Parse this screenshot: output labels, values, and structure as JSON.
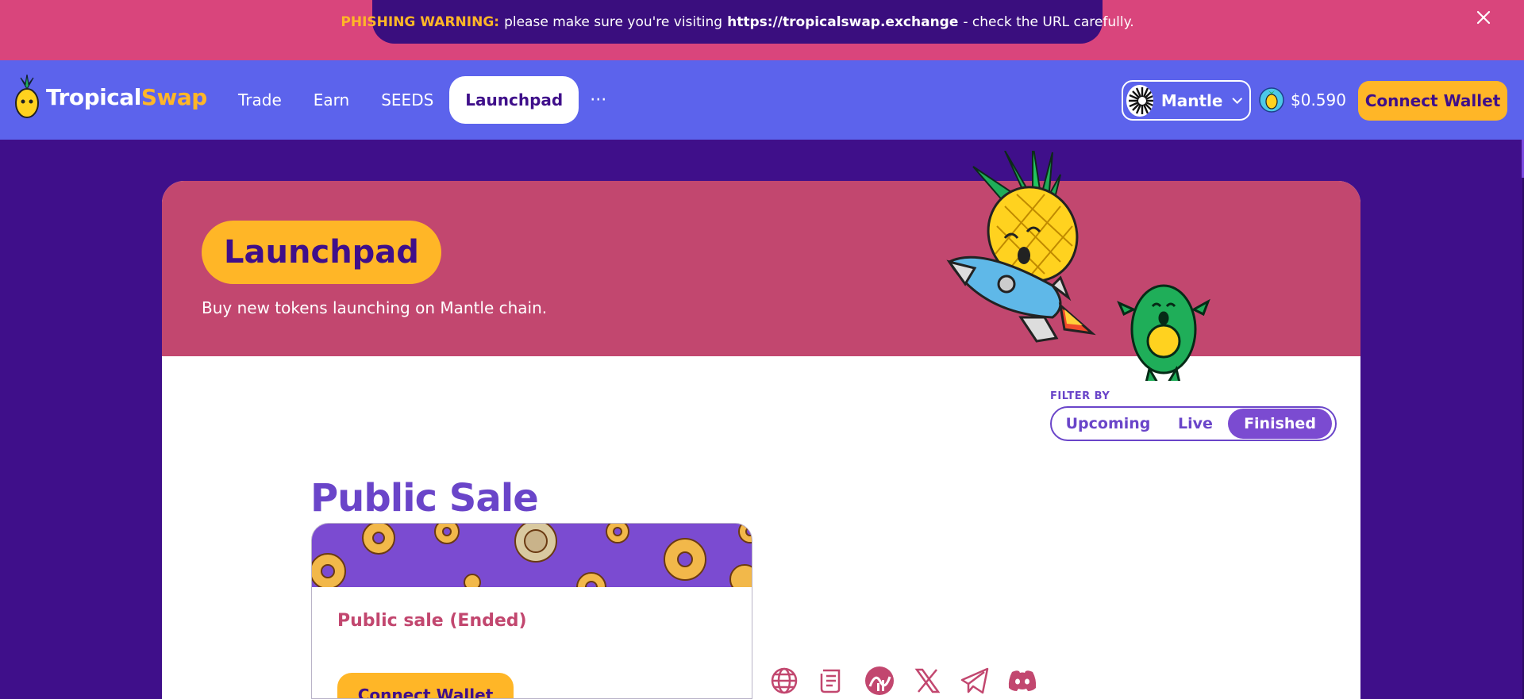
{
  "banner": {
    "label": "PHISHING WARNING:",
    "text_before": "please make sure you're visiting",
    "url": "https://tropicalswap.exchange",
    "text_after": "- check the URL carefully.",
    "close_icon": "close-icon"
  },
  "brand": {
    "name_part1": "Tropical",
    "name_part2": "Swap"
  },
  "nav": {
    "items": [
      {
        "label": "Trade",
        "active": false
      },
      {
        "label": "Earn",
        "active": false
      },
      {
        "label": "SEEDS",
        "active": false
      },
      {
        "label": "Launchpad",
        "active": true
      }
    ],
    "more_label": "···"
  },
  "chain": {
    "label": "Mantle"
  },
  "token_price": "$0.590",
  "connect_wallet_label": "Connect Wallet",
  "hero": {
    "title": "Launchpad",
    "subtitle": "Buy new tokens launching on Mantle chain."
  },
  "filter": {
    "label": "FILTER BY",
    "options": [
      "Upcoming",
      "Live",
      "Finished"
    ],
    "selected": "Finished"
  },
  "section_title": "Public Sale",
  "sale_card": {
    "status": "Public sale (Ended)",
    "button_label": "Connect Wallet"
  },
  "social_icons": [
    "globe-icon",
    "document-icon",
    "chart-icon",
    "x-icon",
    "telegram-icon",
    "discord-icon"
  ],
  "colors": {
    "background": "#3f0f8a",
    "banner_strip": "#d9457c",
    "navbar": "#5c63ec",
    "hero": "#c2476f",
    "accent_yellow": "#ffb627",
    "purple": "#6a45c9"
  }
}
